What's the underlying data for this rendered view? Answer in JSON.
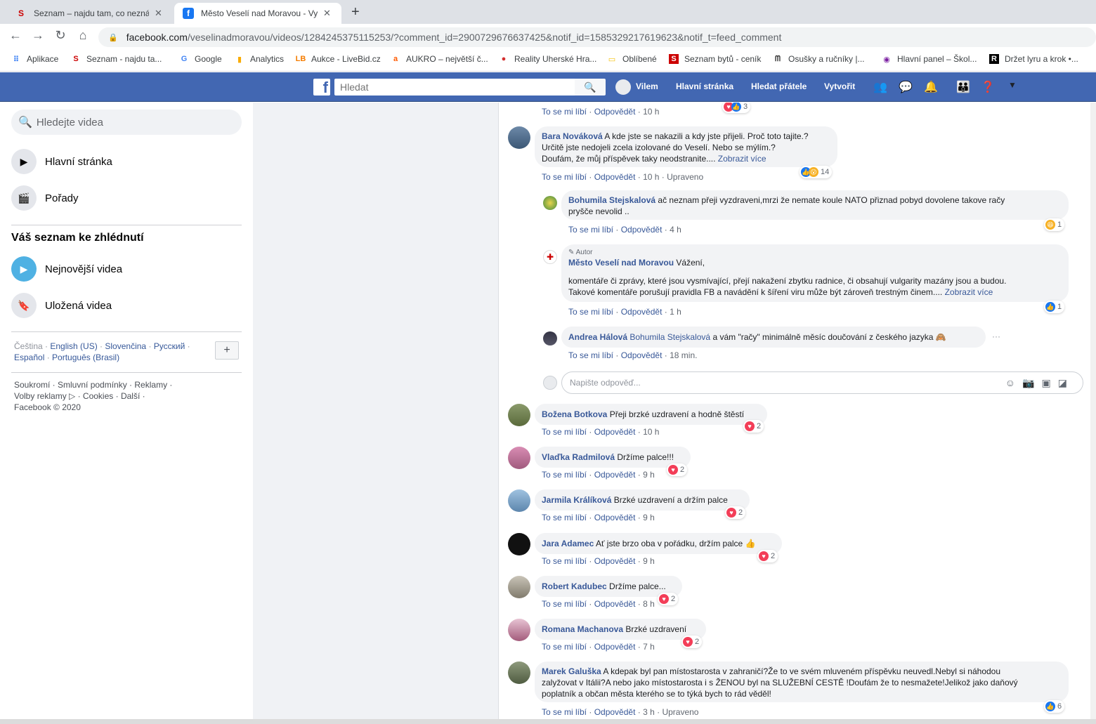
{
  "browser": {
    "tabs": [
      {
        "title": "Seznam – najdu tam, co neznám",
        "favicon": "S",
        "color": "#cc0000"
      },
      {
        "title": "Město Veselí nad Moravou - Vyjá",
        "favicon": "f",
        "color": "#1877f2"
      }
    ],
    "url_domain": "facebook.com",
    "url_path": "/veselinadmoravou/videos/1284245375115253/?comment_id=2900729676637425&notif_id=1585329217619623&notif_t=feed_comment",
    "bookmarks": [
      {
        "label": "Aplikace",
        "icon": "apps-icon"
      },
      {
        "label": "Seznam - najdu ta...",
        "icon": "seznam-icon"
      },
      {
        "label": "Google",
        "icon": "google-icon"
      },
      {
        "label": "Analytics",
        "icon": "analytics-icon"
      },
      {
        "label": "Aukce - LiveBid.cz",
        "icon": "livebid-icon"
      },
      {
        "label": "AUKRO – největší č...",
        "icon": "aukro-icon"
      },
      {
        "label": "Reality Uherské Hra...",
        "icon": "reality-icon"
      },
      {
        "label": "Oblíbené",
        "icon": "folder-icon"
      },
      {
        "label": "Seznam bytů - ceník",
        "icon": "seznam-byty-icon"
      },
      {
        "label": "Osušky a ručníky |...",
        "icon": "osusky-icon"
      },
      {
        "label": "Hlavní panel – Škol...",
        "icon": "panel-icon"
      },
      {
        "label": "Držet lyru a krok •...",
        "icon": "lyra-icon"
      }
    ]
  },
  "fb": {
    "search_placeholder": "Hledat",
    "nav": {
      "user": "Vilem",
      "home": "Hlavní stránka",
      "friends": "Hledat přátele",
      "create": "Vytvořit"
    },
    "brand_color": "#4267b2"
  },
  "left": {
    "search_placeholder": "Hledejte videa",
    "menu": [
      "Hlavní stránka",
      "Pořady"
    ],
    "watchlist_title": "Váš seznam ke zhlédnutí",
    "watchlist": [
      "Nejnovější videa",
      "Uložená videa"
    ],
    "languages": [
      "Čeština",
      "English (US)",
      "Slovenčina",
      "Русский",
      "Español",
      "Português (Brasil)"
    ],
    "lang_add": "+",
    "footer_line1": "Soukromí · Smluvní podmínky · Reklamy ·",
    "footer_line2": "Volby reklamy ▷ · Cookies · Další ·",
    "footer_line3": "Facebook © 2020"
  },
  "labels": {
    "like": "To se mi líbí",
    "reply": "Odpovědět",
    "edited": "Upraveno",
    "author": "Autor",
    "reply_placeholder": "Napište odpověď..."
  },
  "comments": {
    "top": {
      "time": "10 h",
      "reactions": "3"
    },
    "bara": {
      "name": "Bara Nováková",
      "l1": "A kde jste se nakazili a kdy jste přijeli. Proč toto tajite.?",
      "l2": "Určitě jste nedojeli zcela izolované do Veselí. Nebo se mýlím.?",
      "l3": "Doufám, že můj příspěvek taky neodstranite....",
      "more": "Zobrazit více",
      "time": "10 h",
      "reactions": "14"
    },
    "bohumila": {
      "name": "Bohumila Stejskalová",
      "l1": "ač neznam přeji vyzdraveni,mrzi že nemate koule NATO přiznad pobyd dovolene takove račy",
      "l2": "pryšče nevolid ..",
      "time": "4 h",
      "reactions": "1"
    },
    "mesto": {
      "name": "Město Veselí nad Moravou",
      "l1": "Vážení,",
      "l2": "komentáře či zprávy, které jsou vysmívající, přejí nakažení zbytku radnice, či obsahují vulgarity mazány jsou a budou.",
      "l3": "Takové komentáře porušují pravidla FB a navádění k šíření viru může být zároveň trestným činem....",
      "more": "Zobrazit více",
      "time": "1 h",
      "reactions": "1"
    },
    "andrea": {
      "name": "Andrea Hálová",
      "tag": "Bohumila Stejskalová",
      "text": "a vám \"račy\" minimálně měsíc doučování z českého jazyka 🙈",
      "time": "18 min.",
      "menu": "···"
    },
    "bozena": {
      "name": "Božena Botkova",
      "text": "Přeji brzké uzdravení a hodně štěstí",
      "time": "10 h",
      "reactions": "2"
    },
    "vladka": {
      "name": "Vlaďka Radmilová",
      "text": "Držíme palce!!!",
      "time": "9 h",
      "reactions": "2"
    },
    "jarmila": {
      "name": "Jarmila Králíková",
      "text": "Brzké uzdravení a držím palce",
      "time": "9 h",
      "reactions": "2"
    },
    "jara": {
      "name": "Jara Adamec",
      "text": "Ať jste brzo oba v pořádku, držím palce 👍",
      "time": "9 h",
      "reactions": "2"
    },
    "robert": {
      "name": "Robert Kadubec",
      "text": "Držíme palce...",
      "time": "8 h",
      "reactions": "2"
    },
    "romana": {
      "name": "Romana Machanova",
      "text": "Brzké uzdravení",
      "time": "7 h",
      "reactions": "2"
    },
    "marek": {
      "name": "Marek Galuška",
      "l1": "A kdepak byl pan místostarosta v zahraničí?Že to ve svém mluveném příspěvku neuvedl.Nebyl si náhodou",
      "l2": "zalyžovat v Itálii?A nebo jako místostarosta i s ŽENOU byl na SLUŽEBNÍ CESTĚ !Doufám že to nesmažete!Jelikož jako daňový",
      "l3": "poplatník a občan města kterého se to týká bych to rád věděl!",
      "time": "3 h",
      "reactions": "6"
    }
  }
}
